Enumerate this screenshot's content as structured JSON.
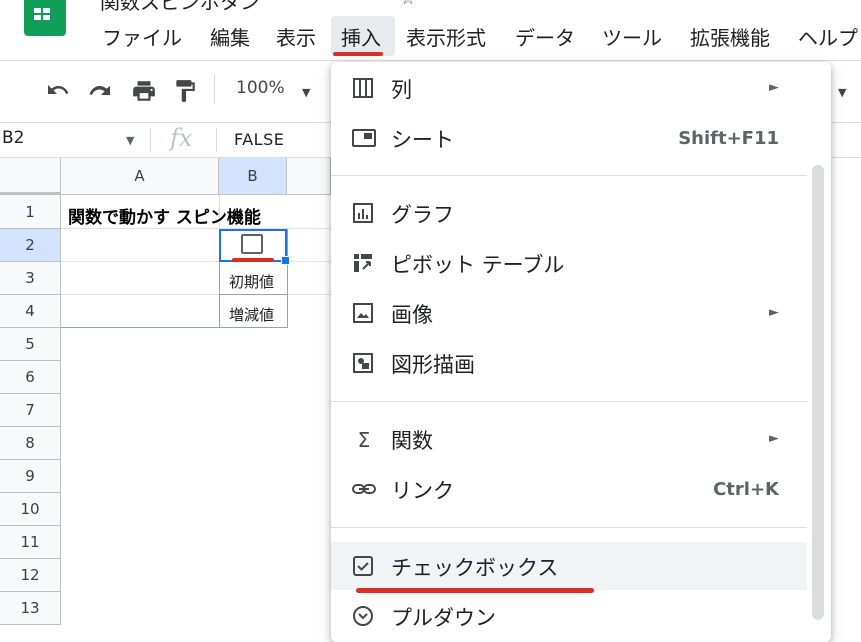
{
  "app": {
    "title": "関数スピンボタン",
    "star_icon": "star-icon"
  },
  "menu": {
    "items": [
      {
        "label": "ファイル"
      },
      {
        "label": "編集"
      },
      {
        "label": "表示"
      },
      {
        "label": "挿入"
      },
      {
        "label": "表示形式"
      },
      {
        "label": "データ"
      },
      {
        "label": "ツール"
      },
      {
        "label": "拡張機能"
      },
      {
        "label": "ヘルプ"
      }
    ],
    "active": "挿入"
  },
  "toolbar": {
    "zoom": "100%"
  },
  "formula_bar": {
    "name_box": "B2",
    "fx": "fx",
    "value": "FALSE"
  },
  "grid": {
    "columns": [
      "A",
      "B"
    ],
    "rows": [
      "1",
      "2",
      "3",
      "4",
      "5",
      "6",
      "7",
      "8",
      "9",
      "10",
      "11",
      "12",
      "13"
    ],
    "selected_row": "2",
    "selected_column": "B",
    "cells": {
      "A1": "関数で動かす スピン機能",
      "B3": "初期値",
      "B4": "増減値"
    }
  },
  "insert_menu": {
    "items": [
      {
        "label": "列",
        "icon": "columns-icon",
        "submenu": true
      },
      {
        "label": "シート",
        "icon": "sheet-icon",
        "shortcut": "Shift+F11"
      },
      {
        "label": "グラフ",
        "icon": "chart-icon"
      },
      {
        "label": "ピボット テーブル",
        "icon": "pivot-table-icon"
      },
      {
        "label": "画像",
        "icon": "image-icon",
        "submenu": true
      },
      {
        "label": "図形描画",
        "icon": "drawing-icon"
      },
      {
        "label": "関数",
        "icon": "sigma-icon",
        "submenu": true
      },
      {
        "label": "リンク",
        "icon": "link-icon",
        "shortcut": "Ctrl+K"
      },
      {
        "label": "チェックボックス",
        "icon": "checkbox-icon",
        "highlighted": true
      },
      {
        "label": "プルダウン",
        "icon": "dropdown-icon"
      }
    ]
  },
  "colors": {
    "accent": "#1a73e8",
    "annotation_red": "#d93025",
    "sheets_green": "#0f9d58"
  }
}
